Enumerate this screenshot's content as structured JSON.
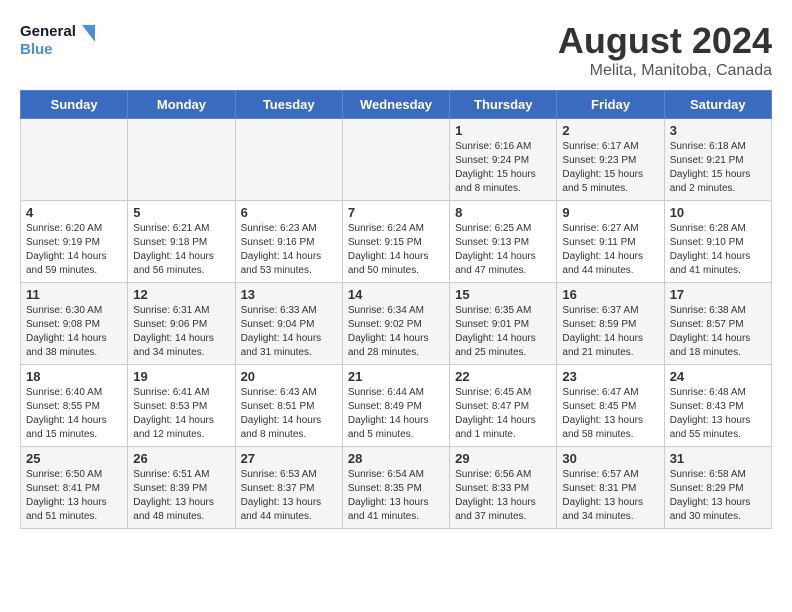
{
  "logo": {
    "line1": "General",
    "line2": "Blue"
  },
  "title": "August 2024",
  "subtitle": "Melita, Manitoba, Canada",
  "headers": [
    "Sunday",
    "Monday",
    "Tuesday",
    "Wednesday",
    "Thursday",
    "Friday",
    "Saturday"
  ],
  "weeks": [
    [
      {
        "day": "",
        "info": ""
      },
      {
        "day": "",
        "info": ""
      },
      {
        "day": "",
        "info": ""
      },
      {
        "day": "",
        "info": ""
      },
      {
        "day": "1",
        "info": "Sunrise: 6:16 AM\nSunset: 9:24 PM\nDaylight: 15 hours\nand 8 minutes."
      },
      {
        "day": "2",
        "info": "Sunrise: 6:17 AM\nSunset: 9:23 PM\nDaylight: 15 hours\nand 5 minutes."
      },
      {
        "day": "3",
        "info": "Sunrise: 6:18 AM\nSunset: 9:21 PM\nDaylight: 15 hours\nand 2 minutes."
      }
    ],
    [
      {
        "day": "4",
        "info": "Sunrise: 6:20 AM\nSunset: 9:19 PM\nDaylight: 14 hours\nand 59 minutes."
      },
      {
        "day": "5",
        "info": "Sunrise: 6:21 AM\nSunset: 9:18 PM\nDaylight: 14 hours\nand 56 minutes."
      },
      {
        "day": "6",
        "info": "Sunrise: 6:23 AM\nSunset: 9:16 PM\nDaylight: 14 hours\nand 53 minutes."
      },
      {
        "day": "7",
        "info": "Sunrise: 6:24 AM\nSunset: 9:15 PM\nDaylight: 14 hours\nand 50 minutes."
      },
      {
        "day": "8",
        "info": "Sunrise: 6:25 AM\nSunset: 9:13 PM\nDaylight: 14 hours\nand 47 minutes."
      },
      {
        "day": "9",
        "info": "Sunrise: 6:27 AM\nSunset: 9:11 PM\nDaylight: 14 hours\nand 44 minutes."
      },
      {
        "day": "10",
        "info": "Sunrise: 6:28 AM\nSunset: 9:10 PM\nDaylight: 14 hours\nand 41 minutes."
      }
    ],
    [
      {
        "day": "11",
        "info": "Sunrise: 6:30 AM\nSunset: 9:08 PM\nDaylight: 14 hours\nand 38 minutes."
      },
      {
        "day": "12",
        "info": "Sunrise: 6:31 AM\nSunset: 9:06 PM\nDaylight: 14 hours\nand 34 minutes."
      },
      {
        "day": "13",
        "info": "Sunrise: 6:33 AM\nSunset: 9:04 PM\nDaylight: 14 hours\nand 31 minutes."
      },
      {
        "day": "14",
        "info": "Sunrise: 6:34 AM\nSunset: 9:02 PM\nDaylight: 14 hours\nand 28 minutes."
      },
      {
        "day": "15",
        "info": "Sunrise: 6:35 AM\nSunset: 9:01 PM\nDaylight: 14 hours\nand 25 minutes."
      },
      {
        "day": "16",
        "info": "Sunrise: 6:37 AM\nSunset: 8:59 PM\nDaylight: 14 hours\nand 21 minutes."
      },
      {
        "day": "17",
        "info": "Sunrise: 6:38 AM\nSunset: 8:57 PM\nDaylight: 14 hours\nand 18 minutes."
      }
    ],
    [
      {
        "day": "18",
        "info": "Sunrise: 6:40 AM\nSunset: 8:55 PM\nDaylight: 14 hours\nand 15 minutes."
      },
      {
        "day": "19",
        "info": "Sunrise: 6:41 AM\nSunset: 8:53 PM\nDaylight: 14 hours\nand 12 minutes."
      },
      {
        "day": "20",
        "info": "Sunrise: 6:43 AM\nSunset: 8:51 PM\nDaylight: 14 hours\nand 8 minutes."
      },
      {
        "day": "21",
        "info": "Sunrise: 6:44 AM\nSunset: 8:49 PM\nDaylight: 14 hours\nand 5 minutes."
      },
      {
        "day": "22",
        "info": "Sunrise: 6:45 AM\nSunset: 8:47 PM\nDaylight: 14 hours\nand 1 minute."
      },
      {
        "day": "23",
        "info": "Sunrise: 6:47 AM\nSunset: 8:45 PM\nDaylight: 13 hours\nand 58 minutes."
      },
      {
        "day": "24",
        "info": "Sunrise: 6:48 AM\nSunset: 8:43 PM\nDaylight: 13 hours\nand 55 minutes."
      }
    ],
    [
      {
        "day": "25",
        "info": "Sunrise: 6:50 AM\nSunset: 8:41 PM\nDaylight: 13 hours\nand 51 minutes."
      },
      {
        "day": "26",
        "info": "Sunrise: 6:51 AM\nSunset: 8:39 PM\nDaylight: 13 hours\nand 48 minutes."
      },
      {
        "day": "27",
        "info": "Sunrise: 6:53 AM\nSunset: 8:37 PM\nDaylight: 13 hours\nand 44 minutes."
      },
      {
        "day": "28",
        "info": "Sunrise: 6:54 AM\nSunset: 8:35 PM\nDaylight: 13 hours\nand 41 minutes."
      },
      {
        "day": "29",
        "info": "Sunrise: 6:56 AM\nSunset: 8:33 PM\nDaylight: 13 hours\nand 37 minutes."
      },
      {
        "day": "30",
        "info": "Sunrise: 6:57 AM\nSunset: 8:31 PM\nDaylight: 13 hours\nand 34 minutes."
      },
      {
        "day": "31",
        "info": "Sunrise: 6:58 AM\nSunset: 8:29 PM\nDaylight: 13 hours\nand 30 minutes."
      }
    ]
  ]
}
